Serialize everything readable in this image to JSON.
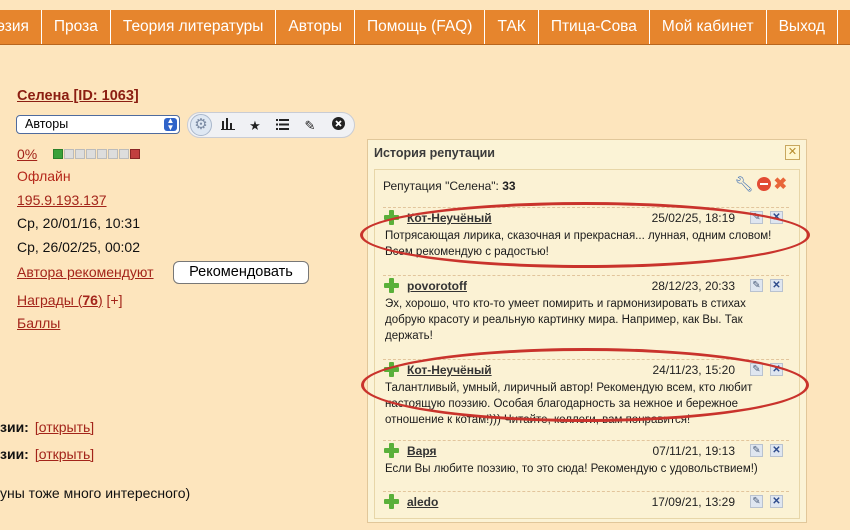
{
  "nav": {
    "items": [
      "эзия",
      "Проза",
      "Теория литературы",
      "Авторы",
      "Помощь (FAQ)",
      "ТАК",
      "Птица-Сова",
      "Мой кабинет",
      "Выход"
    ]
  },
  "profile": {
    "name": "Селена [ID: 1063]",
    "select_value": "Авторы",
    "rating_percent": "0%",
    "status": "Офлайн",
    "ip": "195.9.193.137",
    "date_registered": "Ср, 20/01/16, 10:31",
    "date_last": "Ср, 26/02/25, 00:02",
    "recommend_link": "Автора рекомендуют",
    "recommend_button": "Рекомендовать",
    "awards_label": "Награды (",
    "awards_count": "76",
    "awards_close": ")",
    "awards_add": "[+]",
    "points": "Баллы",
    "row1_label": "зии:",
    "row1_link": "[открыть]",
    "row2_label": "зии:",
    "row2_link": "[открыть]",
    "row3_text": "уны тоже много интересного)"
  },
  "reputation": {
    "title": "История репутации",
    "summary_prefix": "Репутация \"Селена\":",
    "summary_value": "33",
    "entries": [
      {
        "author": "Кот-Неучёный",
        "date": "25/02/25, 18:19",
        "text": "Потрясающая лирика, сказочная и прекрасная... лунная, одним словом! Всем рекомендую с радостью!"
      },
      {
        "author": "povorotoff",
        "date": "28/12/23, 20:33",
        "text": "Эх, хорошо, что кто-то умеет помирить и гармонизировать в стихах добрую красоту и реальную картинку мира. Например, как Вы. Так держать!"
      },
      {
        "author": "Кот-Неучёный",
        "date": "24/11/23, 15:20",
        "text": "Талантливый, умный, лиричный автор! Рекомендую всем, кто любит настоящую поэзию. Особая благодарность за нежное и бережное отношение к котам!))) Читайте, коллеги, вам понравится!"
      },
      {
        "author": "Варя",
        "date": "07/11/21, 19:13",
        "text": "Если Вы любите поэзию, то это сюда! Рекомендую с удовольствием!)"
      },
      {
        "author": "aledo",
        "date": "17/09/21, 13:29",
        "text": ""
      }
    ]
  },
  "colors": {
    "nav_bg": "#e6852d",
    "page_bg": "#fde5bd",
    "link": "#a3241a",
    "annotation": "#c9332c"
  }
}
